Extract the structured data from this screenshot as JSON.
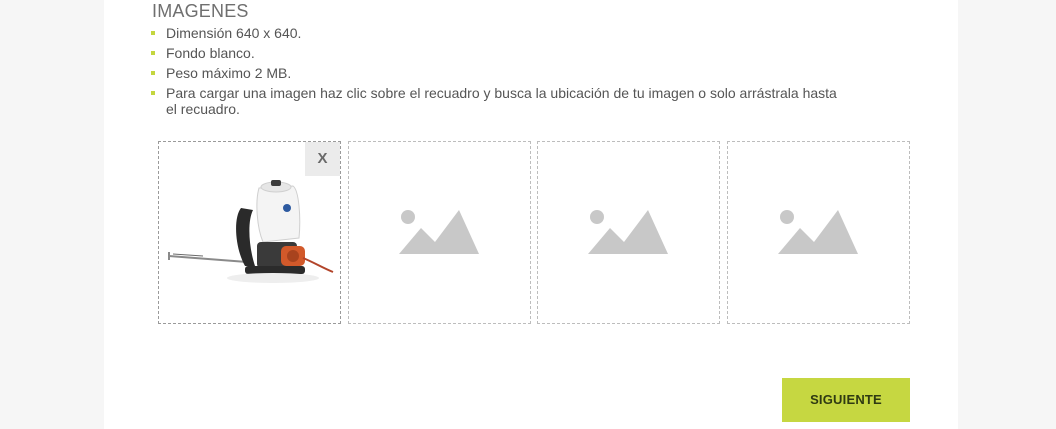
{
  "section": {
    "title": "IMAGENES"
  },
  "requirements": [
    "Dimensión 640 x 640.",
    "Fondo blanco.",
    "Peso máximo 2 MB.",
    "Para cargar una imagen haz clic sobre el recuadro y busca la ubicación de tu imagen o solo arrástrala hasta el recuadro."
  ],
  "upload_slots": [
    {
      "state": "filled",
      "image": "backpack-sprayer-product-image",
      "remove_label": "X"
    },
    {
      "state": "empty",
      "icon": "image-placeholder-icon"
    },
    {
      "state": "empty",
      "icon": "image-placeholder-icon"
    },
    {
      "state": "empty",
      "icon": "image-placeholder-icon"
    }
  ],
  "actions": {
    "next_label": "SIGUIENTE"
  },
  "colors": {
    "accent": "#c6d741",
    "bullet": "#c4d63f",
    "placeholder_icon": "#c8c8c8",
    "page_bg": "#f6f6f6",
    "card_bg": "#ffffff"
  }
}
